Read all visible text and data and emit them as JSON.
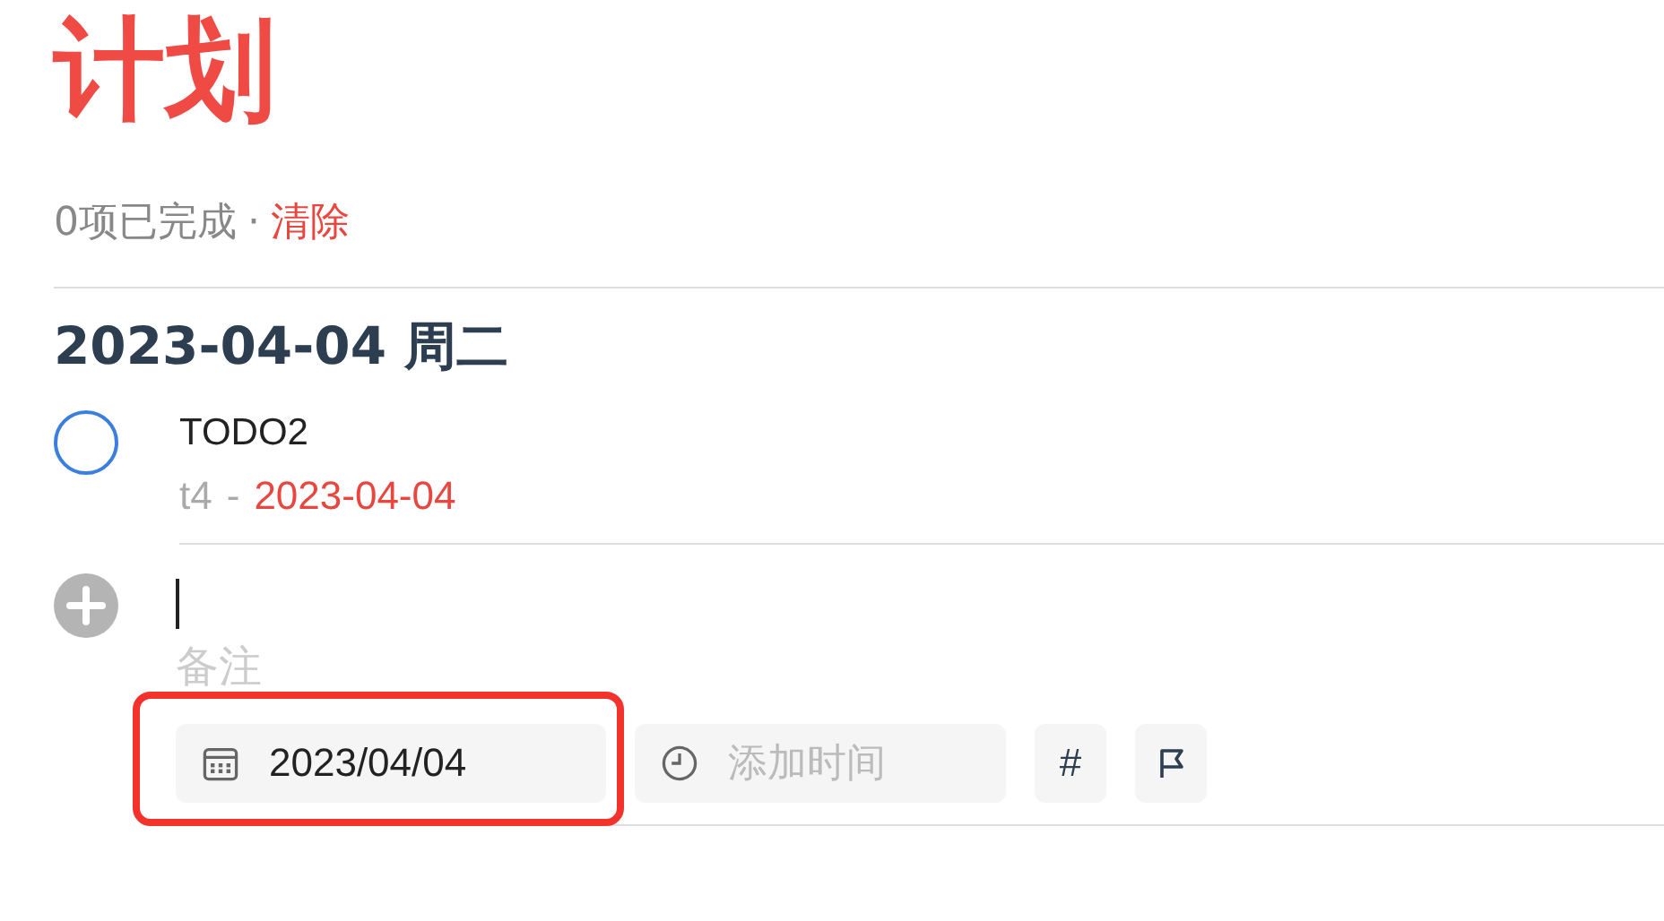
{
  "header": {
    "title": "计划",
    "completed_count": "0项已完成",
    "separator": "·",
    "clear_link": "清除"
  },
  "sections": [
    {
      "date_heading": "2023-04-04 周二",
      "tasks": [
        {
          "title": "TODO2",
          "done": false,
          "list": "t4",
          "separator": "-",
          "due": "2023-04-04"
        }
      ]
    }
  ],
  "new_task": {
    "note_placeholder": "备注",
    "date_value": "2023/04/04",
    "time_placeholder": "添加时间",
    "tag_button": "#"
  }
}
